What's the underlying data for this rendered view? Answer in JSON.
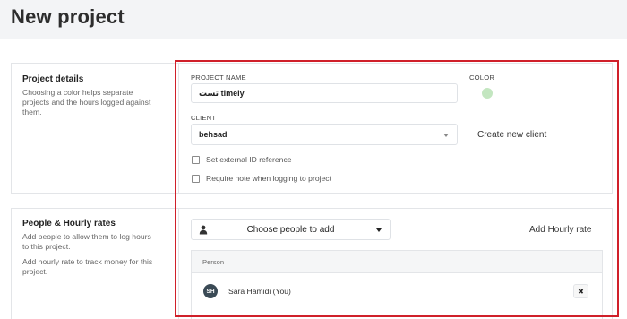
{
  "page": {
    "title": "New project"
  },
  "project_details": {
    "title": "Project details",
    "description": "Choosing a color helps separate projects and the hours logged against them.",
    "project_name_label": "PROJECT NAME",
    "project_name_value": "تست timely",
    "color_label": "COLOR",
    "color_value": "#c3e6c0",
    "client_label": "CLIENT",
    "client_value": "behsad",
    "create_client": "Create new client",
    "external_id_label": "Set external ID reference",
    "require_note_label": "Require note when logging to project"
  },
  "people": {
    "title": "People & Hourly rates",
    "description1": "Add people to allow them to log hours to this project.",
    "description2": "Add hourly rate to track money for this project.",
    "choose_people": "Choose people to add",
    "add_hourly_rate": "Add Hourly rate",
    "table_header": "Person",
    "rows": [
      {
        "initials": "SH",
        "name": "Sara Hamidi (You)",
        "remove": "✖"
      }
    ]
  },
  "icons": {
    "person": "person-icon",
    "caret": "caret-down-icon",
    "close": "close-icon"
  }
}
